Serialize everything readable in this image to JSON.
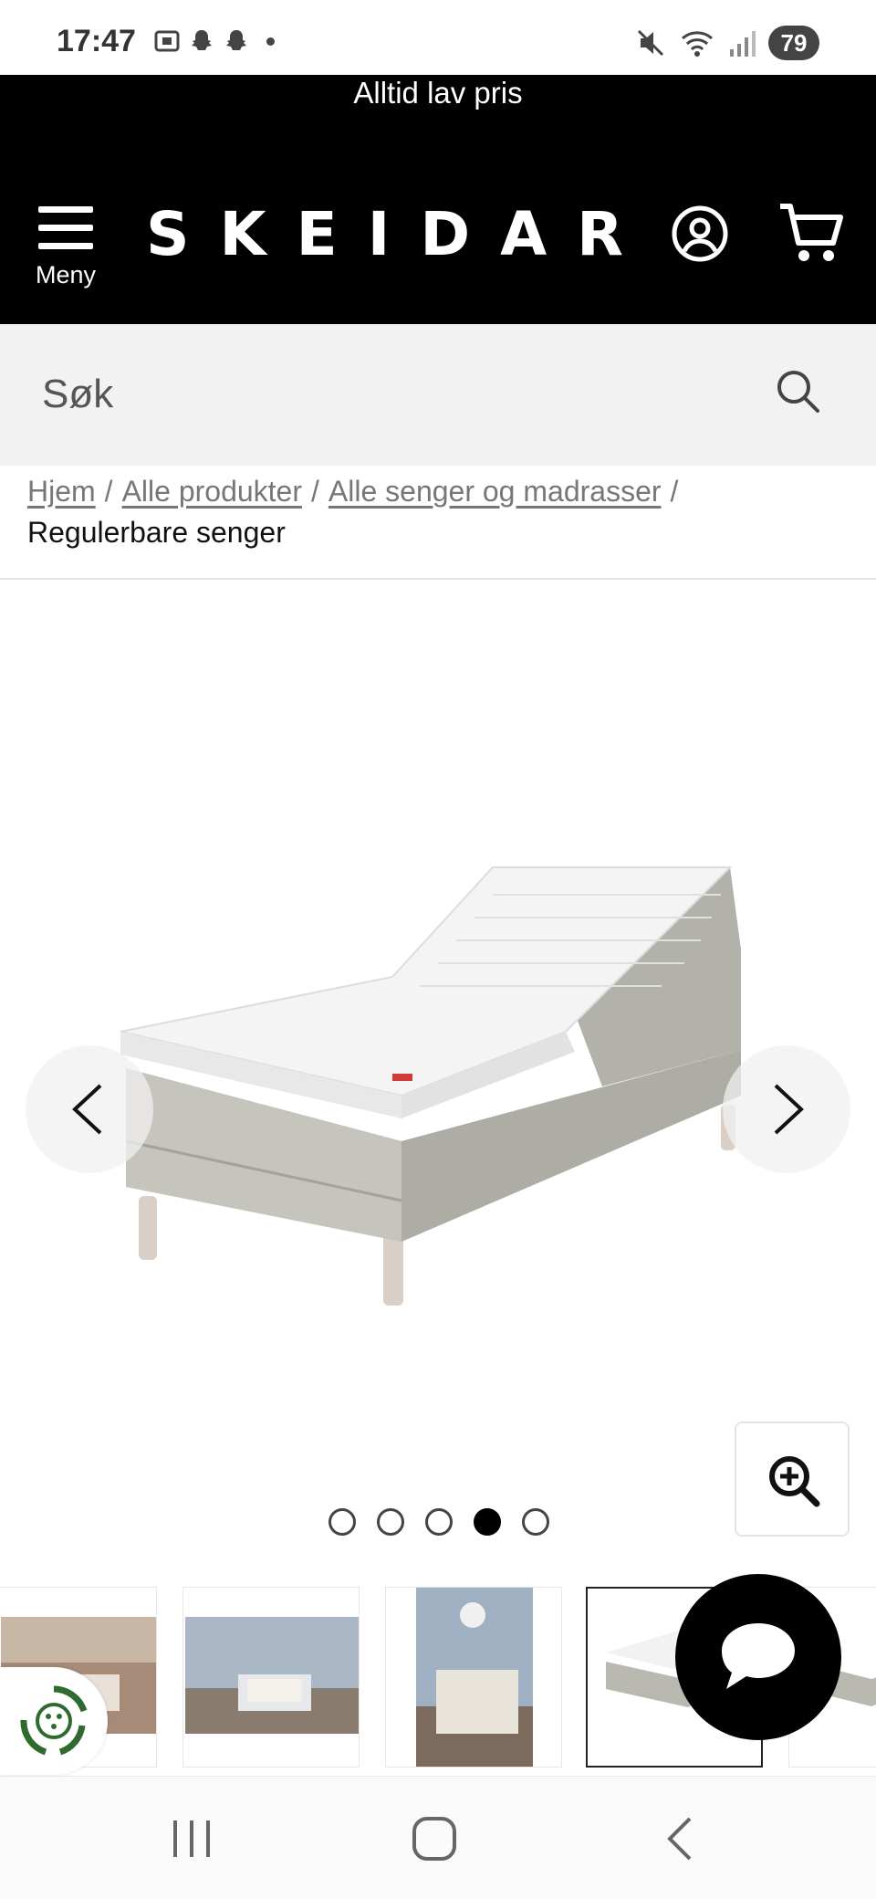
{
  "status_bar": {
    "time": "17:47",
    "battery": "79"
  },
  "header": {
    "promo": "Alltid lav pris",
    "menu_label": "Meny",
    "logo": "SKEIDAR"
  },
  "search": {
    "placeholder": "Søk"
  },
  "breadcrumb": {
    "links": [
      "Hjem",
      "Alle produkter",
      "Alle senger og madrasser"
    ],
    "current": "Regulerbare senger"
  },
  "carousel": {
    "total_images": 5,
    "active_index": 3
  },
  "icons": {
    "menu": "hamburger-icon",
    "account": "account-icon",
    "cart": "cart-icon",
    "search": "search-icon",
    "prev": "chevron-left-icon",
    "next": "chevron-right-icon",
    "zoom": "zoom-in-icon",
    "chat": "chat-bubble-icon",
    "eco": "recycle-icon"
  },
  "colors": {
    "header_bg": "#000000",
    "search_bg": "#f2f2f2",
    "eco_green": "#2f6b2f"
  }
}
